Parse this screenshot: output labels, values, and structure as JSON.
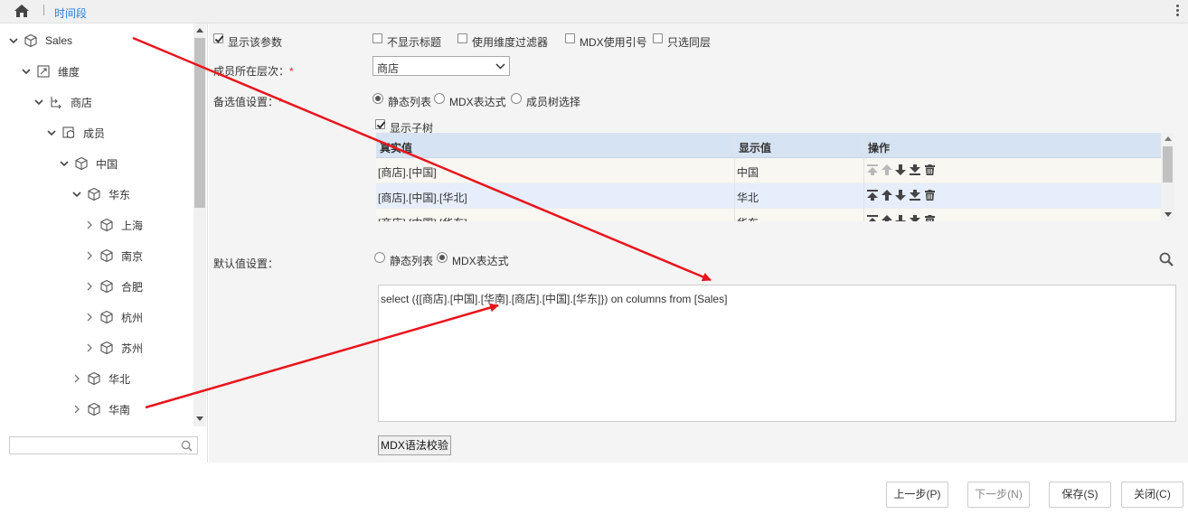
{
  "breadcrumb": {
    "title": "时间段"
  },
  "tree": {
    "nodes": [
      {
        "label": "Sales",
        "icon": "cube-icon",
        "chevron": "down"
      },
      {
        "label": "维度",
        "icon": "dimension-icon",
        "chevron": "down"
      },
      {
        "label": "商店",
        "icon": "hierarchy-icon",
        "chevron": "down"
      },
      {
        "label": "成员",
        "icon": "members-icon",
        "chevron": "down"
      },
      {
        "label": "中国",
        "icon": "cube-icon",
        "chevron": "down"
      },
      {
        "label": "华东",
        "icon": "cube-icon",
        "chevron": "down"
      },
      {
        "label": "上海",
        "icon": "cube-icon",
        "chevron": "right"
      },
      {
        "label": "南京",
        "icon": "cube-icon",
        "chevron": "right"
      },
      {
        "label": "合肥",
        "icon": "cube-icon",
        "chevron": "right"
      },
      {
        "label": "杭州",
        "icon": "cube-icon",
        "chevron": "right"
      },
      {
        "label": "苏州",
        "icon": "cube-icon",
        "chevron": "right"
      },
      {
        "label": "华北",
        "icon": "cube-icon",
        "chevron": "right"
      },
      {
        "label": "华南",
        "icon": "cube-icon",
        "chevron": "right"
      }
    ],
    "search_placeholder": ""
  },
  "form": {
    "show_param": {
      "label": "显示该参数",
      "checked": true
    },
    "hide_title": {
      "label": "不显示标题",
      "checked": false
    },
    "dim_filter": {
      "label": "使用维度过滤器",
      "checked": false
    },
    "mdx_quote": {
      "label": "MDX使用引号",
      "checked": false
    },
    "same_level": {
      "label": "只选同层",
      "checked": false
    },
    "level_label": "成员所在层次：",
    "level_value": "商店",
    "candidate_label": "备选值设置：",
    "candidate_options": [
      "静态列表",
      "MDX表达式",
      "成员树选择"
    ],
    "candidate_selected": "静态列表",
    "show_subtree": {
      "label": "显示子树",
      "checked": true
    },
    "grid": {
      "headers": [
        "真实值",
        "显示值",
        "操作"
      ],
      "rows": [
        {
          "real": "[商店].[中国]",
          "display": "中国"
        },
        {
          "real": "[商店].[中国].[华北]",
          "display": "华北"
        },
        {
          "real": "[商店].[中国].[华东]",
          "display": "华东"
        }
      ]
    },
    "default_label": "默认值设置：",
    "default_options": [
      "静态列表",
      "MDX表达式"
    ],
    "default_selected": "MDX表达式",
    "mdx_text": "select ({[商店].[中国].[华南].[商店].[中国].[华东]}) on columns from [Sales]",
    "mdx_check_button": "MDX语法校验"
  },
  "footer": {
    "prev": "上一步(P)",
    "next": "下一步(N)",
    "save": "保存(S)",
    "close": "关闭(C)"
  },
  "colors": {
    "link": "#2f7ed8",
    "header_bg": "#d6e3f2",
    "arrow": "#e8141c",
    "panel_bg": "#f4f4f4"
  }
}
